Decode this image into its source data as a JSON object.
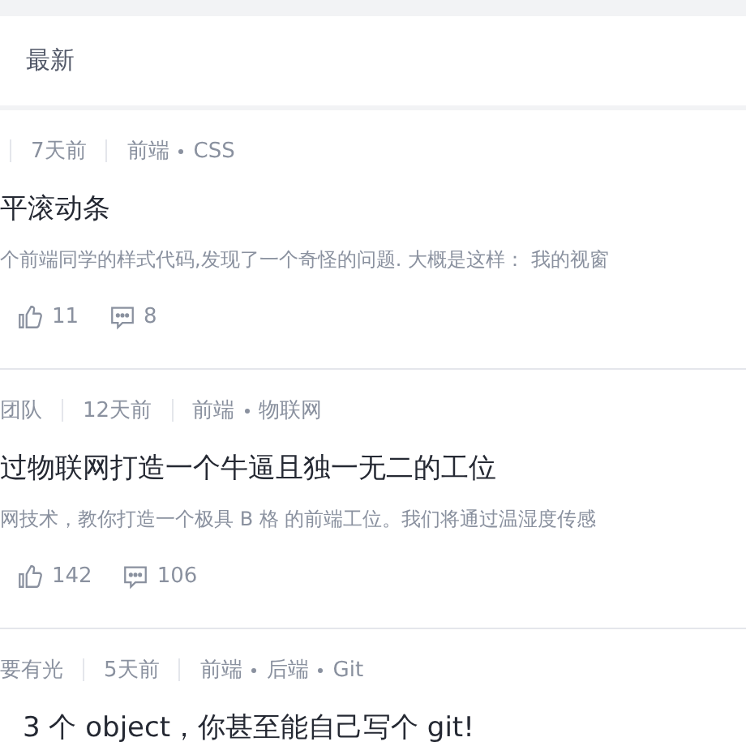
{
  "header": {
    "tab": "最新"
  },
  "articles": [
    {
      "time": "7天前",
      "tags": [
        "前端",
        "CSS"
      ],
      "title": "平滚动条",
      "abstract": "个前端同学的样式代码,发现了一个奇怪的问题. 大概是这样： 我的视窗",
      "likes": "11",
      "comments": "8"
    },
    {
      "author": "团队",
      "time": "12天前",
      "tags": [
        "前端",
        "物联网"
      ],
      "title": "过物联网打造一个牛逼且独一无二的工位",
      "abstract": "网技术，教你打造一个极具 B 格 的前端工位。我们将通过温湿度传感",
      "likes": "142",
      "comments": "106"
    },
    {
      "author": "要有光",
      "time": "5天前",
      "tags": [
        "前端",
        "后端",
        "Git"
      ],
      "title": "3 个 object，你甚至能自己写个 git!"
    }
  ]
}
